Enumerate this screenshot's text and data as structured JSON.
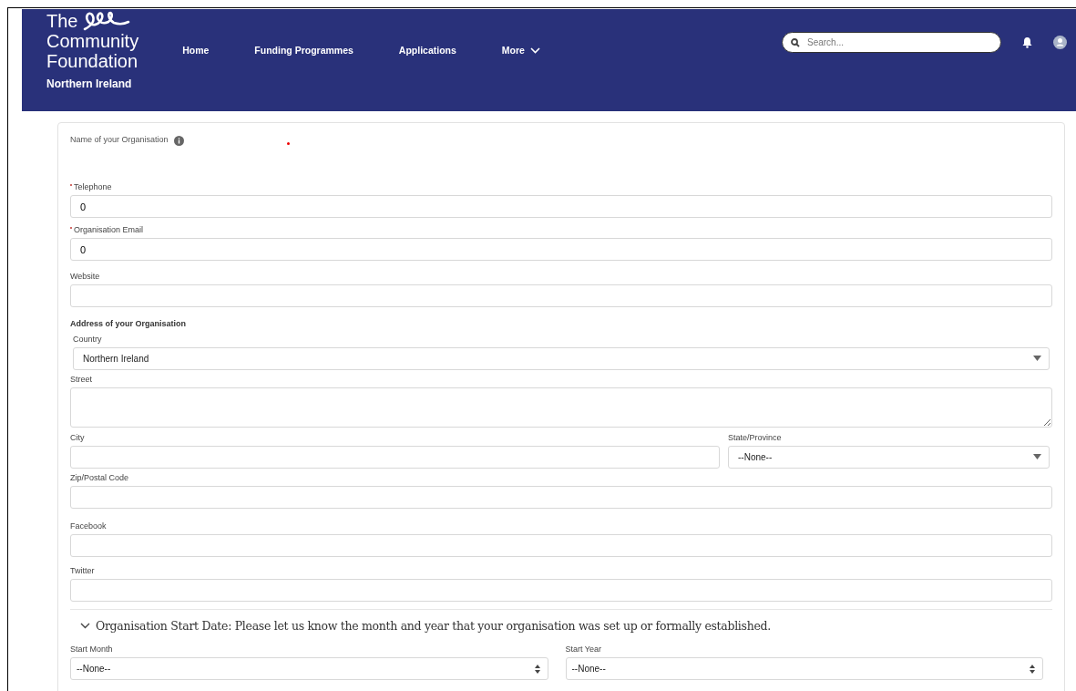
{
  "header": {
    "logo": [
      "The",
      "Community",
      "Foundation",
      "Northern Ireland"
    ],
    "nav": [
      {
        "label": "Home",
        "dropdown": false
      },
      {
        "label": "Funding Programmes",
        "dropdown": false
      },
      {
        "label": "Applications",
        "dropdown": false
      },
      {
        "label": "More",
        "dropdown": true
      }
    ],
    "search": {
      "placeholder": "Search..."
    }
  },
  "form": {
    "name_label": "Name of your Organisation",
    "fields": [
      {
        "kind": "text",
        "label": "Telephone",
        "required": true,
        "value": "0"
      },
      {
        "kind": "text",
        "label": "Organisation Email",
        "required": true,
        "value": "0"
      },
      {
        "kind": "text",
        "label": "Website",
        "required": false
      },
      {
        "kind": "heading",
        "label": "Address of your Organisation"
      },
      {
        "kind": "select",
        "label": "Country",
        "value": "Northern Ireland"
      },
      {
        "kind": "textarea",
        "label": "Street"
      },
      {
        "kind": "pair",
        "items": [
          {
            "kind": "text",
            "label": "City"
          },
          {
            "kind": "select",
            "label": "State/Province",
            "value": "--None--"
          }
        ]
      },
      {
        "kind": "text",
        "label": "Zip/Postal Code"
      },
      {
        "kind": "text",
        "label": "Facebook"
      },
      {
        "kind": "text",
        "label": "Twitter"
      }
    ],
    "section": {
      "title": "Organisation Start Date: Please let us know the month and year that your organisation was set up or formally established.",
      "expanded": true,
      "fields": [
        {
          "label": "Start Month",
          "value": "--None--"
        },
        {
          "label": "Start Year",
          "value": "--None--"
        }
      ]
    }
  }
}
